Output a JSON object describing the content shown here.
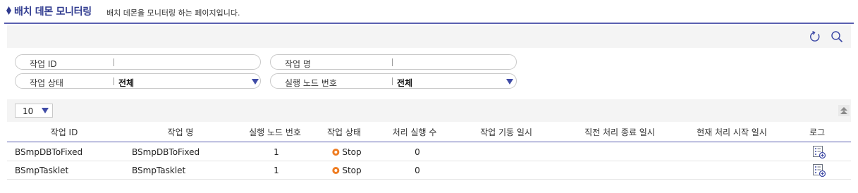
{
  "page": {
    "title": "배치 데몬 모니터링",
    "description": "배치 데몬을 모니터링 하는 페이지입니다."
  },
  "toolbar": {
    "icons": [
      "refresh-icon",
      "search-icon"
    ]
  },
  "filters": {
    "job_id": {
      "label": "작업 ID",
      "value": ""
    },
    "job_name": {
      "label": "작업 명",
      "value": ""
    },
    "job_status": {
      "label": "작업 상태",
      "value": "전체"
    },
    "node_number": {
      "label": "실행 노드 번호",
      "value": "전체"
    }
  },
  "grid": {
    "page_size": "10",
    "columns": [
      "작업 ID",
      "작업 명",
      "실행 노드 번호",
      "작업 상태",
      "처리 실행 수",
      "작업 기동 일시",
      "직전 처리 종료 일시",
      "현재 처리 시작 일시",
      "로그"
    ],
    "rows": [
      {
        "job_id": "BSmpDBToFixed",
        "job_name": "BSmpDBToFixed",
        "node": "1",
        "status": "Stop",
        "exec_count": "0",
        "start_time": "",
        "last_end": "",
        "current_start": ""
      },
      {
        "job_id": "BSmpTasklet",
        "job_name": "BSmpTasklet",
        "node": "1",
        "status": "Stop",
        "exec_count": "0",
        "start_time": "",
        "last_end": "",
        "current_start": ""
      }
    ]
  },
  "colors": {
    "accent": "#2f3a8f",
    "line": "#5a5fb0",
    "status_stop": "#ef7d22"
  }
}
